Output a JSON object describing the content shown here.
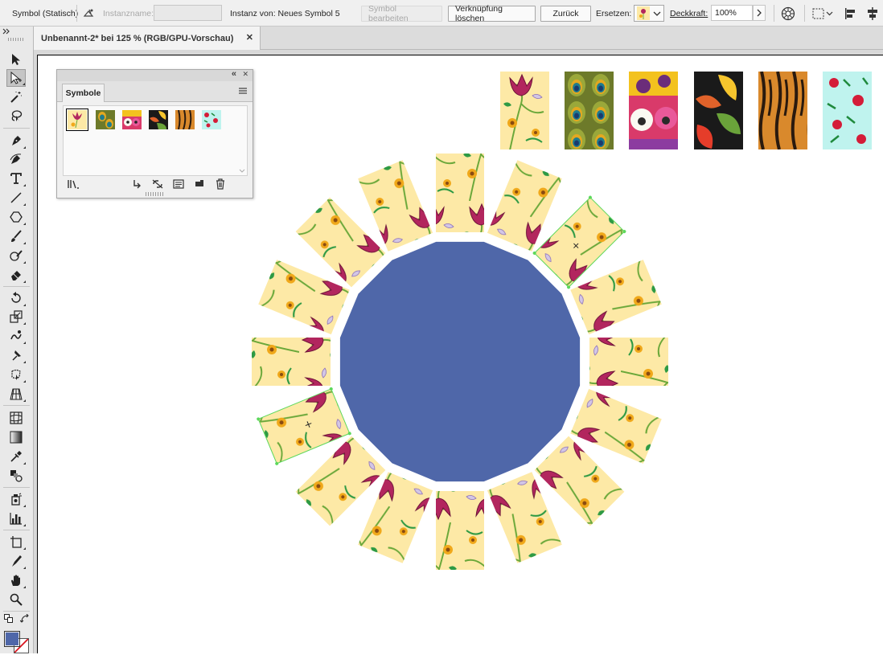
{
  "controlbar": {
    "symbol_type": "Symbol (Statisch)",
    "instance_name_label": "Instanzname:",
    "instance_name_value": "",
    "instance_of_label": "Instanz von: Neues Symbol 5",
    "edit_symbol": "Symbol bearbeiten",
    "break_link": "Verknüpfung löschen",
    "reset": "Zurück",
    "replace_label": "Ersetzen:",
    "opacity_label": "Deckkraft:",
    "opacity_value": "100%"
  },
  "document": {
    "tab_title": "Unbenannt-2* bei 125 % (RGB/GPU-Vorschau)",
    "close_glyph": "✕"
  },
  "symbols_panel": {
    "tab_label": "Symbole",
    "collapse_glyph": "«",
    "close_glyph": "✕",
    "symbols": [
      "flower-pink",
      "peacock",
      "pansy",
      "leaves",
      "tiger",
      "tropical"
    ]
  },
  "tools": [
    "selection-icon",
    "direct-selection-icon",
    "magic-wand-icon",
    "lasso-icon",
    "pen-icon",
    "curvature-icon",
    "type-icon",
    "line-icon",
    "polygon-icon",
    "brush-icon",
    "blob-brush-icon",
    "eraser-icon",
    "rotate-icon",
    "scale-icon",
    "warp-icon",
    "puppet-warp-icon",
    "free-transform-icon",
    "perspective-grid-icon",
    "mesh-icon",
    "gradient-icon",
    "eyedropper-icon",
    "blend-icon",
    "symbol-sprayer-icon",
    "graph-icon",
    "artboard-icon",
    "slice-icon",
    "hand-icon",
    "zoom-icon"
  ],
  "colors": {
    "fill": "#4f67a9",
    "circle": "#4f67a9",
    "tile_bg": "#fde9a6",
    "selection": "#5cd85c"
  }
}
